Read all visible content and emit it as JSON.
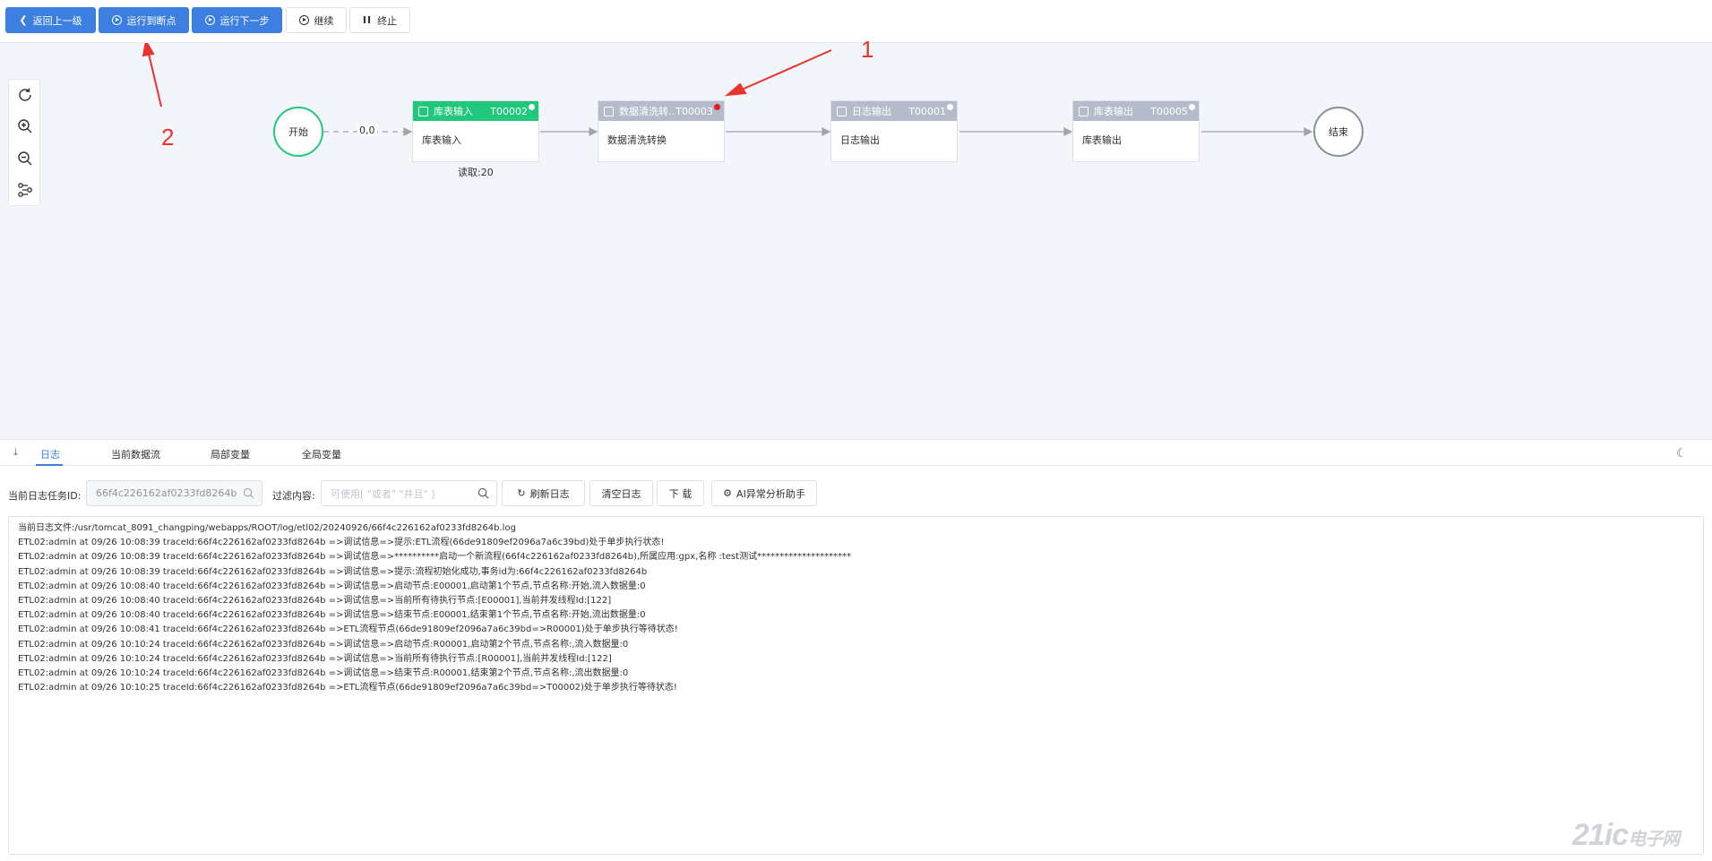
{
  "toolbar": {
    "back_label": "返回上一级",
    "run_to_breakpoint_label": "运行到断点",
    "run_next_step_label": "运行下一步",
    "continue_label": "继续",
    "stop_label": "终止"
  },
  "annotations": {
    "arrow1_label": "1",
    "arrow2_label": "2"
  },
  "flow": {
    "start_label": "开始",
    "end_label": "结束",
    "edge_label": "0,0",
    "nodes": [
      {
        "title": "库表输入",
        "code": "T00002",
        "body": "库表输入",
        "status": "读取:20",
        "header_color": "#1fc87a",
        "breakpoint": false
      },
      {
        "title": "数据清洗转...",
        "code": "T00003",
        "body": "数据清洗转换",
        "status": "",
        "header_color": "#b4bccb",
        "breakpoint": true
      },
      {
        "title": "日志输出",
        "code": "T00001",
        "body": "日志输出",
        "status": "",
        "header_color": "#b4bccb",
        "breakpoint": false
      },
      {
        "title": "库表输出",
        "code": "T00005",
        "body": "库表输出",
        "status": "",
        "header_color": "#b4bccb",
        "breakpoint": false
      }
    ]
  },
  "tabs": [
    "日志",
    "当前数据流",
    "局部变量",
    "全局变量"
  ],
  "filters": {
    "task_id_label": "当前日志任务ID:",
    "task_id_value": "66f4c226162af0233fd8264b",
    "filter_label": "过滤内容:",
    "filter_placeholder": "可使用[ \"或者\"  \"并且\" ]",
    "refresh_label": "刷新日志",
    "clear_label": "清空日志",
    "download_label": "下 载",
    "ai_label": "AI异常分析助手"
  },
  "log_lines": [
    "当前日志文件:/usr/tomcat_8091_changping/webapps/ROOT/log/etl02/20240926/66f4c226162af0233fd8264b.log",
    "ETL02:admin at 09/26 10:08:39 traceId:66f4c226162af0233fd8264b =>调试信息=>提示:ETL流程(66de91809ef2096a7a6c39bd)处于单步执行状态!",
    "ETL02:admin at 09/26 10:08:39 traceId:66f4c226162af0233fd8264b =>调试信息=>**********启动一个新流程(66f4c226162af0233fd8264b),所属应用:gpx,名称 :test测试*********************",
    "ETL02:admin at 09/26 10:08:39 traceId:66f4c226162af0233fd8264b =>调试信息=>提示:流程初始化成功,事务id为:66f4c226162af0233fd8264b",
    "ETL02:admin at 09/26 10:08:40 traceId:66f4c226162af0233fd8264b =>调试信息=>启动节点:E00001,启动第1个节点,节点名称:开始,流入数据量:0",
    "ETL02:admin at 09/26 10:08:40 traceId:66f4c226162af0233fd8264b =>调试信息=>当前所有待执行节点:[E00001],当前并发线程Id:[122]",
    "ETL02:admin at 09/26 10:08:40 traceId:66f4c226162af0233fd8264b =>调试信息=>结束节点:E00001,结束第1个节点,节点名称:开始,流出数据量:0",
    "ETL02:admin at 09/26 10:08:41 traceId:66f4c226162af0233fd8264b =>ETL流程节点(66de91809ef2096a7a6c39bd=>R00001)处于单步执行等待状态!",
    "ETL02:admin at 09/26 10:10:24 traceId:66f4c226162af0233fd8264b =>调试信息=>启动节点:R00001,启动第2个节点,节点名称:,流入数据量:0",
    "ETL02:admin at 09/26 10:10:24 traceId:66f4c226162af0233fd8264b =>调试信息=>当前所有待执行节点:[R00001],当前并发线程Id:[122]",
    "ETL02:admin at 09/26 10:10:24 traceId:66f4c226162af0233fd8264b =>调试信息=>结束节点:R00001,结束第2个节点,节点名称:,流出数据量:0",
    "ETL02:admin at 09/26 10:10:25 traceId:66f4c226162af0233fd8264b =>ETL流程节点(66de91809ef2096a7a6c39bd=>T00002)处于单步执行等待状态!"
  ],
  "watermark": {
    "main": "21ic",
    "sub": "电子网"
  },
  "colors": {
    "primary": "#3d7fe0",
    "start_border": "#1fc87a",
    "breakpoint": "#e02020",
    "annotation": "#e8332e"
  }
}
